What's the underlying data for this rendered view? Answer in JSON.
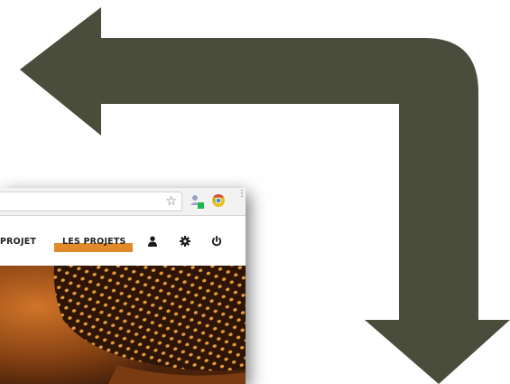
{
  "colors": {
    "arrow": "#4b4d3c",
    "nav_accent": "#e08a2a",
    "hero_dark": "#3a1c0a",
    "hero_orange": "#c0661e",
    "polka_dot": "#e49a3a"
  },
  "browser": {
    "toolbar_icons": [
      "star-icon",
      "extension-user-icon",
      "chrome-extension-icon",
      "menu-icon"
    ],
    "star_glyph": "☆",
    "menu_glyph": "⋮"
  },
  "nav": {
    "items": [
      {
        "label": "PROJET",
        "active": false
      },
      {
        "label": "LES PROJETS",
        "active": true
      }
    ],
    "icons": [
      "user-icon",
      "settings-gear-icon",
      "power-icon"
    ]
  }
}
